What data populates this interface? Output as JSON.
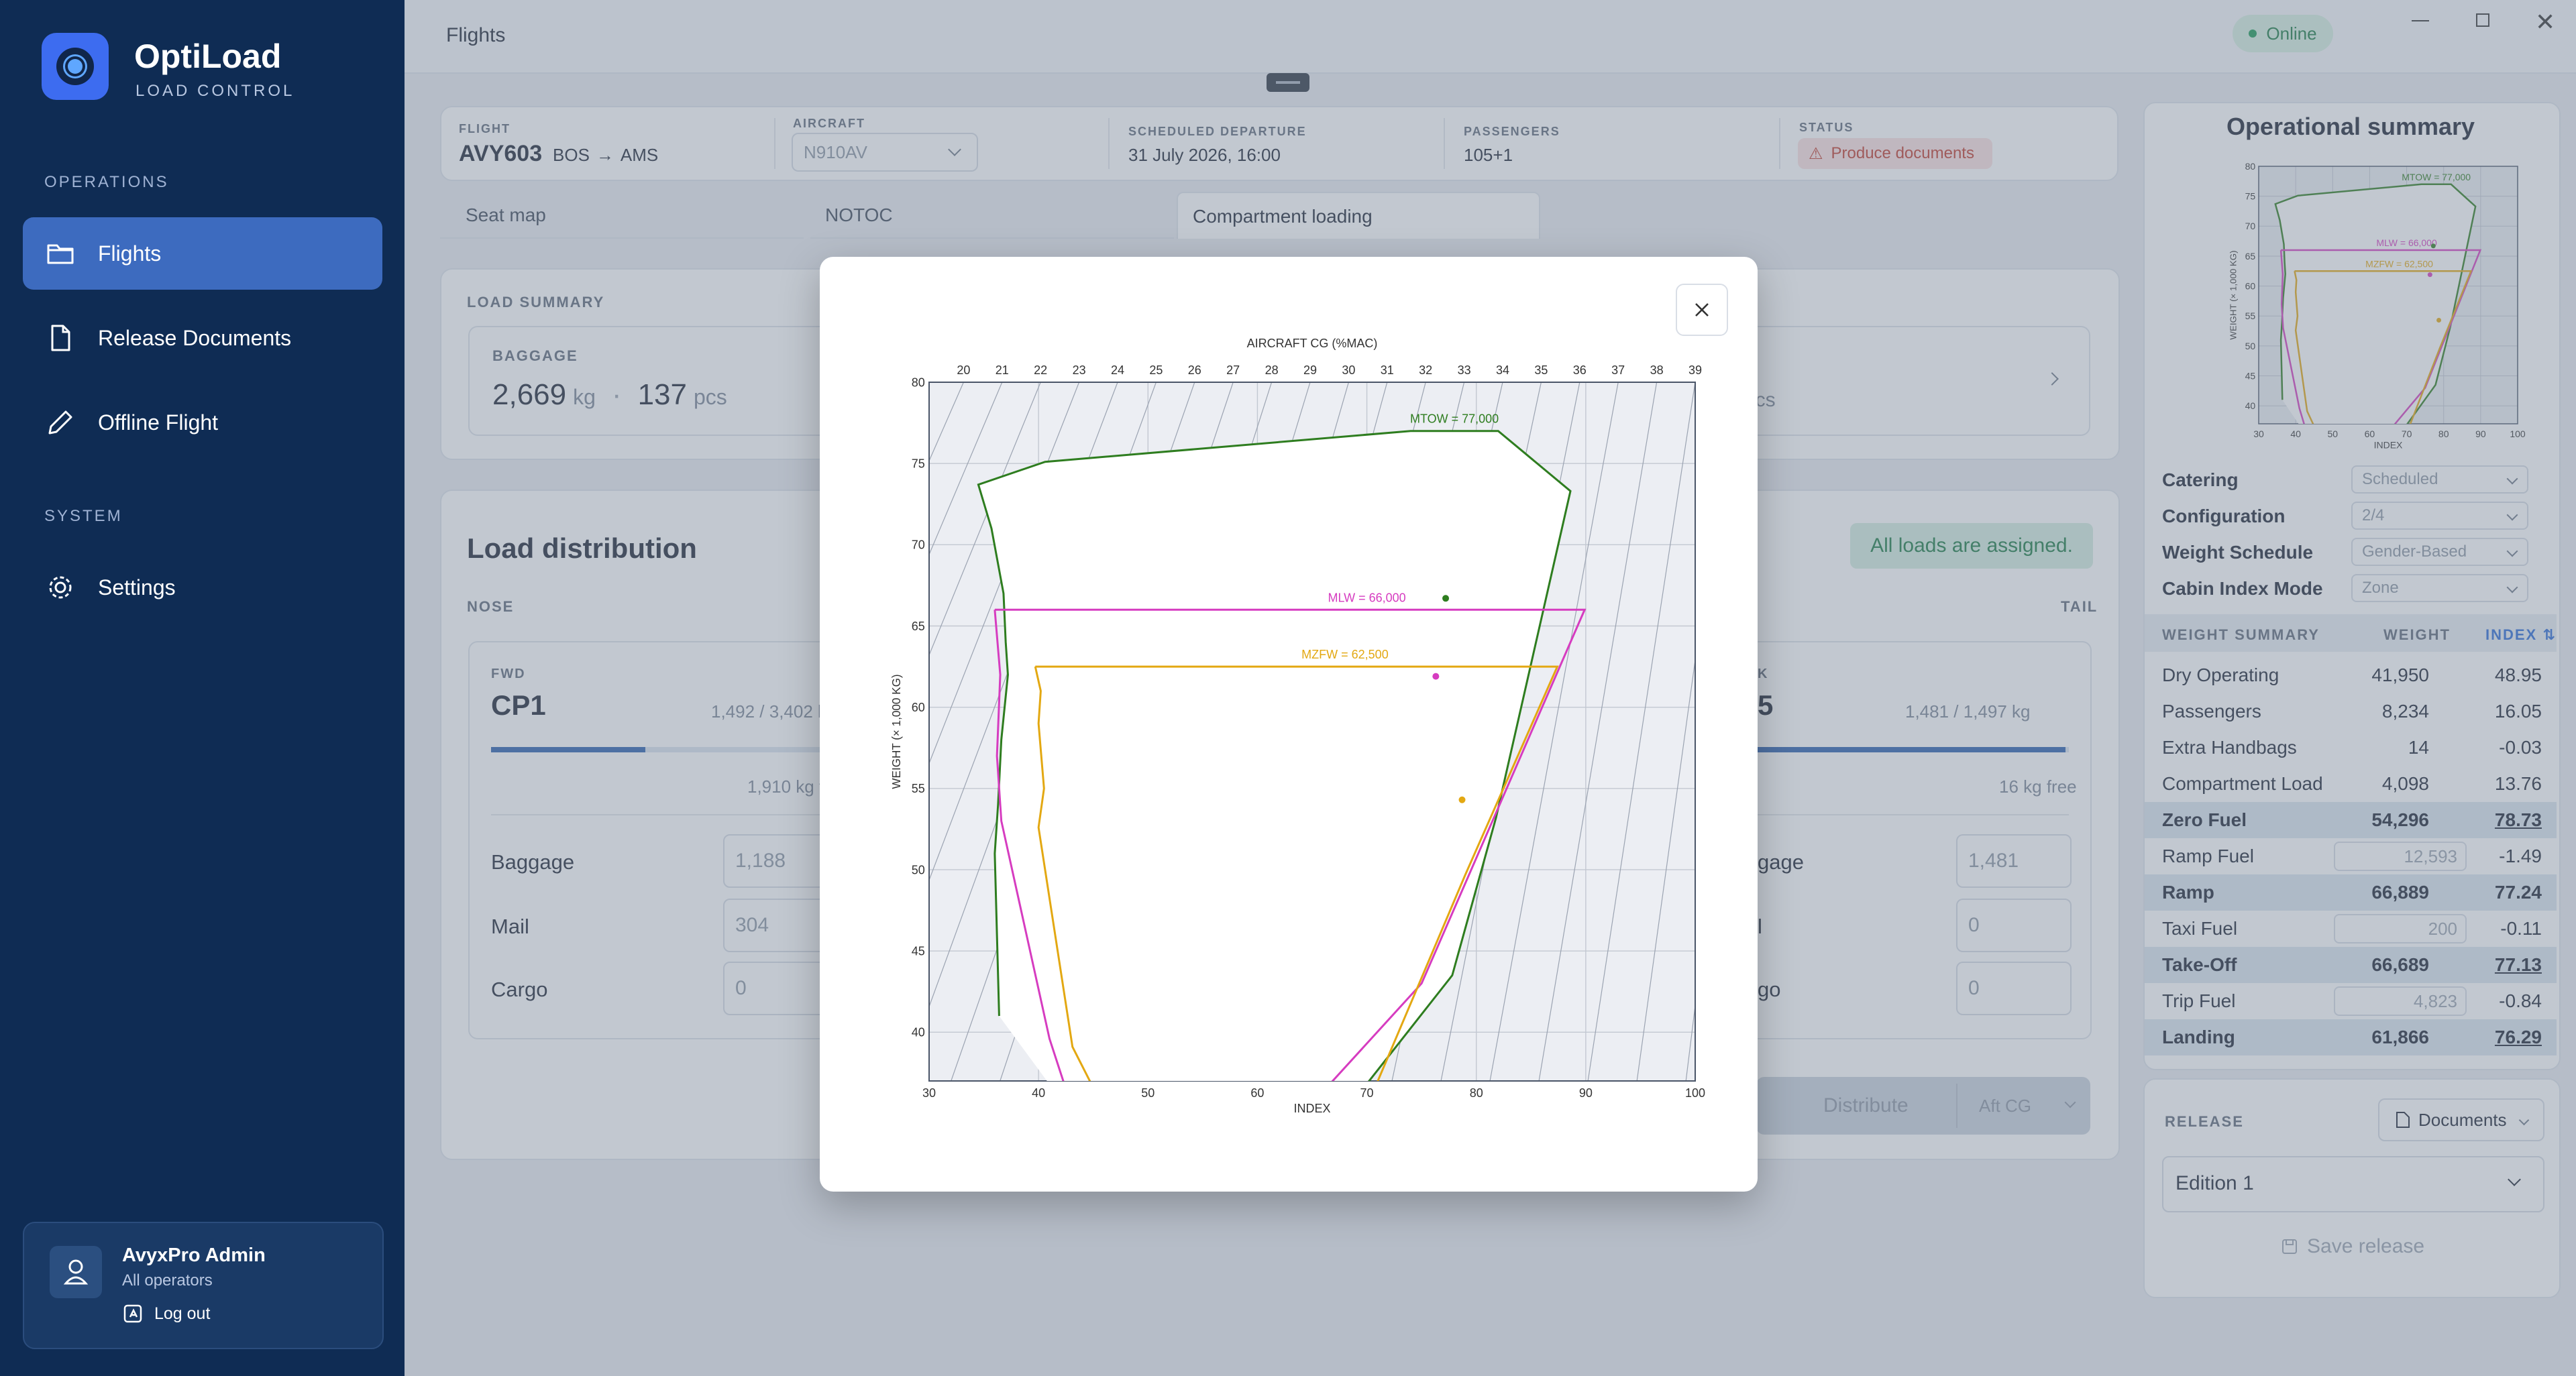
{
  "app": {
    "name": "OptiLoad",
    "subtitle": "LOAD CONTROL"
  },
  "sidebar": {
    "sections": [
      {
        "label": "OPERATIONS",
        "items": [
          {
            "label": "Flights",
            "icon": "folder-icon",
            "active": true
          },
          {
            "label": "Release Documents",
            "icon": "document-icon",
            "active": false
          },
          {
            "label": "Offline Flight",
            "icon": "pencil-icon",
            "active": false
          }
        ]
      },
      {
        "label": "SYSTEM",
        "items": [
          {
            "label": "Settings",
            "icon": "gear-icon",
            "active": false
          }
        ]
      }
    ],
    "user": {
      "name": "AvyxPro Admin",
      "role": "All operators",
      "logout": "Log out"
    }
  },
  "topbar": {
    "title": "Flights",
    "status": "Online"
  },
  "flight": {
    "flight_label": "FLIGHT",
    "flight_no": "AVY603",
    "origin": "BOS",
    "destination": "AMS",
    "aircraft_label": "AIRCRAFT",
    "aircraft": "N910AV",
    "departure_label": "SCHEDULED DEPARTURE",
    "departure": "31 July 2026, 16:00",
    "passengers_label": "PASSENGERS",
    "passengers": "105+1",
    "status_label": "STATUS",
    "status": "Produce documents"
  },
  "tabs": [
    "Seat map",
    "NOTOC",
    "Compartment loading"
  ],
  "load_summary": {
    "title": "LOAD SUMMARY",
    "baggage_label": "BAGGAGE",
    "baggage_kg": "2,669",
    "kg_unit": "kg",
    "baggage_pcs": "137",
    "pcs_unit": "pcs",
    "right_unit": "pcs"
  },
  "load_distribution": {
    "title": "Load distribution",
    "assigned": "All loads are assigned.",
    "nose": "NOSE",
    "tail": "TAIL",
    "fwd": {
      "label": "FWD",
      "name": "CP1",
      "usage": "1,492 / 3,402 k",
      "free": "1,910 kg fr",
      "rows": [
        {
          "label": "Baggage",
          "value": "1,188"
        },
        {
          "label": "Mail",
          "value": "304"
        },
        {
          "label": "Cargo",
          "value": "0"
        }
      ]
    },
    "aft": {
      "label": "K",
      "name": "5",
      "usage": "1,481 / 1,497 kg",
      "free": "16 kg free",
      "rows": [
        {
          "label": "gage",
          "value": "1,481"
        },
        {
          "label": "l",
          "value": "0"
        },
        {
          "label": "go",
          "value": "0"
        }
      ]
    },
    "distribute": "Distribute",
    "aft_cg": "Aft CG"
  },
  "summary": {
    "title": "Operational summary",
    "config": [
      {
        "label": "Catering",
        "value": "Scheduled"
      },
      {
        "label": "Configuration",
        "value": "2/4"
      },
      {
        "label": "Weight Schedule",
        "value": "Gender-Based"
      },
      {
        "label": "Cabin Index Mode",
        "value": "Zone"
      }
    ],
    "weight_header": {
      "label": "WEIGHT SUMMARY",
      "weight": "WEIGHT",
      "index": "INDEX"
    },
    "rows": [
      {
        "label": "Dry Operating",
        "weight": "41,950",
        "index": "48.95",
        "bold": false,
        "input": false
      },
      {
        "label": "Passengers",
        "weight": "8,234",
        "index": "16.05",
        "bold": false,
        "input": false
      },
      {
        "label": "Extra Handbags",
        "weight": "14",
        "index": "-0.03",
        "bold": false,
        "input": false
      },
      {
        "label": "Compartment Load",
        "weight": "4,098",
        "index": "13.76",
        "bold": false,
        "input": false
      },
      {
        "label": "Zero Fuel",
        "weight": "54,296",
        "index": "78.73",
        "bold": true,
        "input": false
      },
      {
        "label": "Ramp Fuel",
        "weight": "12,593",
        "index": "-1.49",
        "bold": false,
        "input": true
      },
      {
        "label": "Ramp",
        "weight": "66,889",
        "index": "77.24",
        "bold": true,
        "input": false
      },
      {
        "label": "Taxi Fuel",
        "weight": "200",
        "index": "-0.11",
        "bold": false,
        "input": true
      },
      {
        "label": "Take-Off",
        "weight": "66,689",
        "index": "77.13",
        "bold": true,
        "input": false
      },
      {
        "label": "Trip Fuel",
        "weight": "4,823",
        "index": "-0.84",
        "bold": false,
        "input": true
      },
      {
        "label": "Landing",
        "weight": "61,866",
        "index": "76.29",
        "bold": true,
        "input": false
      }
    ],
    "release_label": "RELEASE",
    "documents": "Documents",
    "edition": "Edition 1",
    "save": "Save release"
  },
  "chart_data": {
    "type": "line",
    "title": "",
    "top_axis_label": "AIRCRAFT CG (%MAC)",
    "top_ticks": [
      "20",
      "21",
      "22",
      "23",
      "24",
      "25",
      "26",
      "27",
      "28",
      "29",
      "30",
      "31",
      "32",
      "33",
      "34",
      "35",
      "36",
      "37",
      "38",
      "39"
    ],
    "xlabel": "INDEX",
    "ylabel": "WEIGHT (× 1,000 KG)",
    "xlim": [
      30,
      100
    ],
    "ylim": [
      37,
      80
    ],
    "x_ticks": [
      30,
      40,
      50,
      60,
      70,
      80,
      90,
      100
    ],
    "y_ticks": [
      40,
      45,
      50,
      55,
      60,
      65,
      70,
      75,
      80
    ],
    "series": [
      {
        "name": "MTOW = 77,000",
        "color": "#2e7d1f",
        "points": [
          [
            36.4,
            41.0
          ],
          [
            36.0,
            51.0
          ],
          [
            36.3,
            54.0
          ],
          [
            36.6,
            58.0
          ],
          [
            37.2,
            62.0
          ],
          [
            37.0,
            64.0
          ],
          [
            36.8,
            67.0
          ],
          [
            35.7,
            71.0
          ],
          [
            34.5,
            73.7
          ],
          [
            40.6,
            75.1
          ],
          [
            74.0,
            77.0
          ],
          [
            82.0,
            77.0
          ],
          [
            88.6,
            73.3
          ],
          [
            81.8,
            53.2
          ],
          [
            77.8,
            43.5
          ],
          [
            66.0,
            33.4
          ],
          [
            51.0,
            33.4
          ],
          [
            44.7,
            33.4
          ]
        ]
      },
      {
        "name": "MLW = 66,000",
        "color": "#d63cc0",
        "points": [
          [
            36.0,
            66.0
          ],
          [
            89.9,
            66.0
          ],
          [
            75.0,
            43.0
          ],
          [
            62.0,
            33.4
          ],
          [
            47.5,
            33.4
          ],
          [
            44.0,
            33.4
          ],
          [
            41.0,
            39.6
          ],
          [
            36.6,
            53.0
          ],
          [
            36.2,
            57.0
          ],
          [
            36.5,
            62.0
          ],
          [
            36.0,
            66.0
          ]
        ]
      },
      {
        "name": "MZFW = 62,500",
        "color": "#e3a812",
        "points": [
          [
            39.7,
            62.5
          ],
          [
            87.4,
            62.5
          ],
          [
            79.0,
            49.7
          ],
          [
            71.0,
            37.0
          ],
          [
            70.3,
            33.4
          ],
          [
            47.4,
            33.4
          ],
          [
            43.1,
            39.1
          ],
          [
            40.0,
            52.6
          ],
          [
            40.5,
            55.0
          ],
          [
            40.0,
            59.0
          ],
          [
            40.2,
            61.0
          ],
          [
            39.7,
            62.5
          ]
        ]
      }
    ],
    "markers": [
      {
        "series": "MTOW = 77,000",
        "x": 77.2,
        "y": 66.7
      },
      {
        "series": "MLW = 66,000",
        "x": 76.3,
        "y": 61.9
      },
      {
        "series": "MZFW = 62,500",
        "x": 78.7,
        "y": 54.3
      }
    ]
  }
}
